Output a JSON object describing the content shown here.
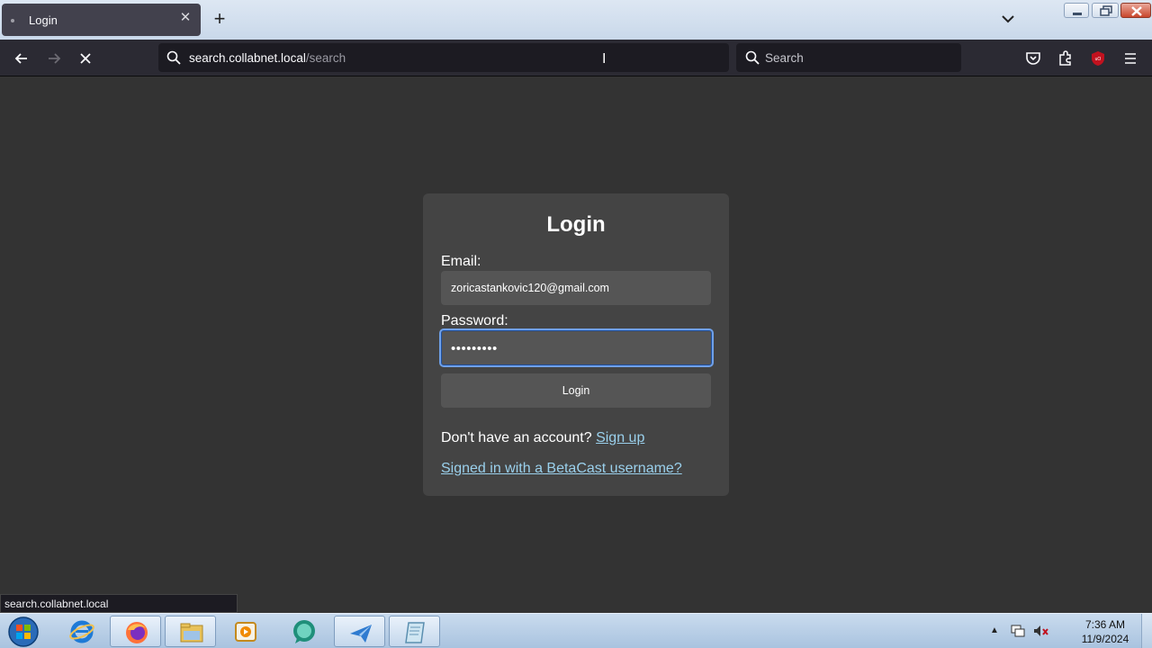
{
  "tab": {
    "title": "Login",
    "close_glyph": "✕"
  },
  "new_tab_glyph": "+",
  "urlbar": {
    "host": "search.collabnet.local",
    "path": "/search"
  },
  "searchbar": {
    "placeholder": "Search"
  },
  "login": {
    "title": "Login",
    "email_label": "Email:",
    "email_value": "zoricastankovic120@gmail.com",
    "password_label": "Password:",
    "password_value": "•••••••••",
    "button_label": "Login",
    "signup_prompt": "Don't have an account?",
    "signup_link": "Sign up",
    "betacast_link": "Signed in with a BetaCast username?"
  },
  "status_bar": {
    "text": "search.collabnet.local"
  },
  "taskbar": {
    "clock_time": "7:36 AM",
    "clock_date": "11/9/2024",
    "tray_chevron": "▲"
  },
  "colors": {
    "page_bg": "#333333",
    "card_bg": "#444444",
    "input_bg": "#555555",
    "link": "#9ad0ec",
    "focus_ring": "#6fa0e8",
    "ublock_red": "#c1121f"
  },
  "icons": [
    "back-arrow-icon",
    "forward-arrow-icon",
    "stop-icon",
    "search-icon",
    "pocket-icon",
    "puzzle-icon",
    "ublock-icon",
    "hamburger-icon"
  ]
}
